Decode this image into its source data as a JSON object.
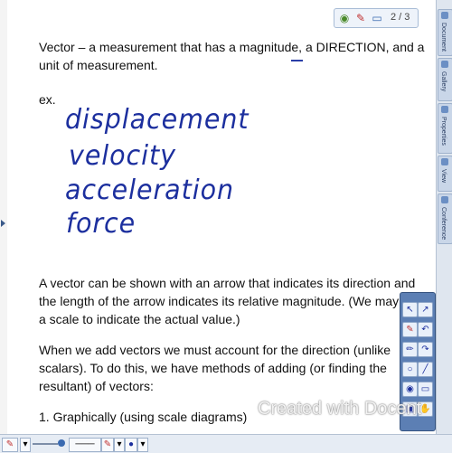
{
  "pager": {
    "page_label": "2 / 3"
  },
  "content": {
    "def_line1": "Vector – a measurement that has a magnitude, a DIRECTION, and a",
    "def_line2": "unit of measurement.",
    "ex_label": "ex.",
    "hand_words": [
      "displacement",
      "velocity",
      "acceleration",
      "force"
    ],
    "para1_line1": "A vector can be shown with an arrow that indicates its direction and",
    "para1_line2": "the length of the arrow indicates its relative magnitude.  (We may use",
    "para1_line3": "a scale to indicate the actual value.)",
    "para2_line1": "When we add vectors we must account for the direction (unlike",
    "para2_line2": "scalars).  To do this, we have methods of adding (or finding the",
    "para2_line3": "resultant) of vectors:",
    "list_item1": "1.  Graphically (using scale diagrams)"
  },
  "sidebar_tabs": [
    "Document",
    "Gallery",
    "Properties",
    "View",
    "Conference"
  ],
  "watermark": "Created with Docent",
  "colors": {
    "ink": "#1c2f9e",
    "accent": "#5c7fb4"
  }
}
